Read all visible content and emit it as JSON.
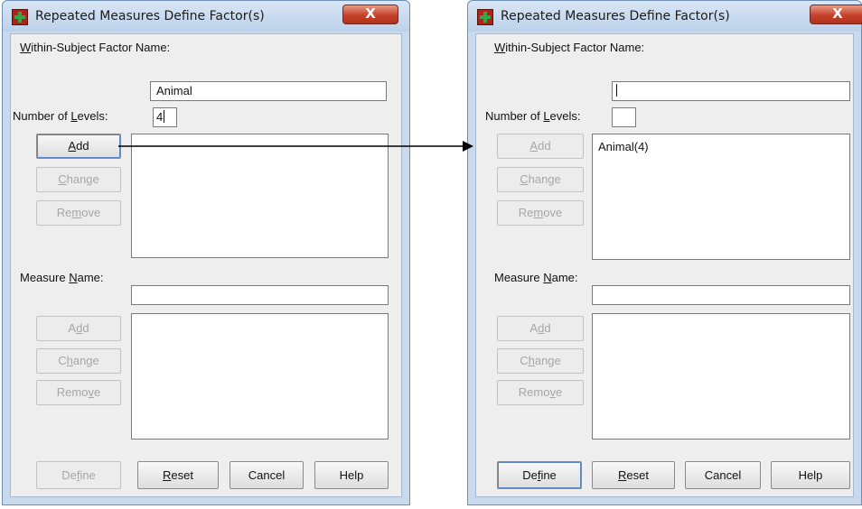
{
  "left_window": {
    "title": "Repeated Measures Define Factor(s)",
    "close_label": "X",
    "factor_name_label_first": "W",
    "factor_name_label_rest": "ithin-Subject Factor Name:",
    "factor_name_value": "Animal",
    "levels_label_pre": "Number of ",
    "levels_label_key": "L",
    "levels_label_post": "evels:",
    "levels_value": "4",
    "add_pre": "",
    "add_key": "A",
    "add_post": "dd",
    "change_pre": "",
    "change_key": "C",
    "change_post": "hange",
    "remove_pre": "Re",
    "remove_key": "m",
    "remove_post": "ove",
    "factors_list": "",
    "measure_label_pre": "Measure ",
    "measure_label_key": "N",
    "measure_label_post": "ame:",
    "measure_value": "",
    "m_add_pre": "A",
    "m_add_key": "d",
    "m_add_post": "d",
    "m_change_pre": "C",
    "m_change_key": "h",
    "m_change_post": "ange",
    "m_remove_pre": "Remo",
    "m_remove_key": "v",
    "m_remove_post": "e",
    "define_pre": "De",
    "define_key": "f",
    "define_post": "ine",
    "reset_pre": "",
    "reset_key": "R",
    "reset_post": "eset",
    "cancel": "Cancel",
    "help": "Help"
  },
  "right_window": {
    "title": "Repeated Measures Define Factor(s)",
    "close_label": "X",
    "factor_name_label_first": "W",
    "factor_name_label_rest": "ithin-Subject Factor Name:",
    "factor_name_value": "",
    "levels_label_pre": "Number of ",
    "levels_label_key": "L",
    "levels_label_post": "evels:",
    "levels_value": "",
    "add_pre": "",
    "add_key": "A",
    "add_post": "dd",
    "change_pre": "",
    "change_key": "C",
    "change_post": "hange",
    "remove_pre": "Re",
    "remove_key": "m",
    "remove_post": "ove",
    "factors_list": "Animal(4)",
    "measure_label_pre": "Measure ",
    "measure_label_key": "N",
    "measure_label_post": "ame:",
    "measure_value": "",
    "m_add_pre": "A",
    "m_add_key": "d",
    "m_add_post": "d",
    "m_change_pre": "C",
    "m_change_key": "h",
    "m_change_post": "ange",
    "m_remove_pre": "Remo",
    "m_remove_key": "v",
    "m_remove_post": "e",
    "define_pre": "De",
    "define_key": "f",
    "define_post": "ine",
    "reset_pre": "",
    "reset_key": "R",
    "reset_post": "eset",
    "cancel": "Cancel",
    "help": "Help"
  },
  "colors": {
    "window_frame": "#c9daee",
    "close_button": "#c5412a",
    "arrow": "#000000"
  }
}
